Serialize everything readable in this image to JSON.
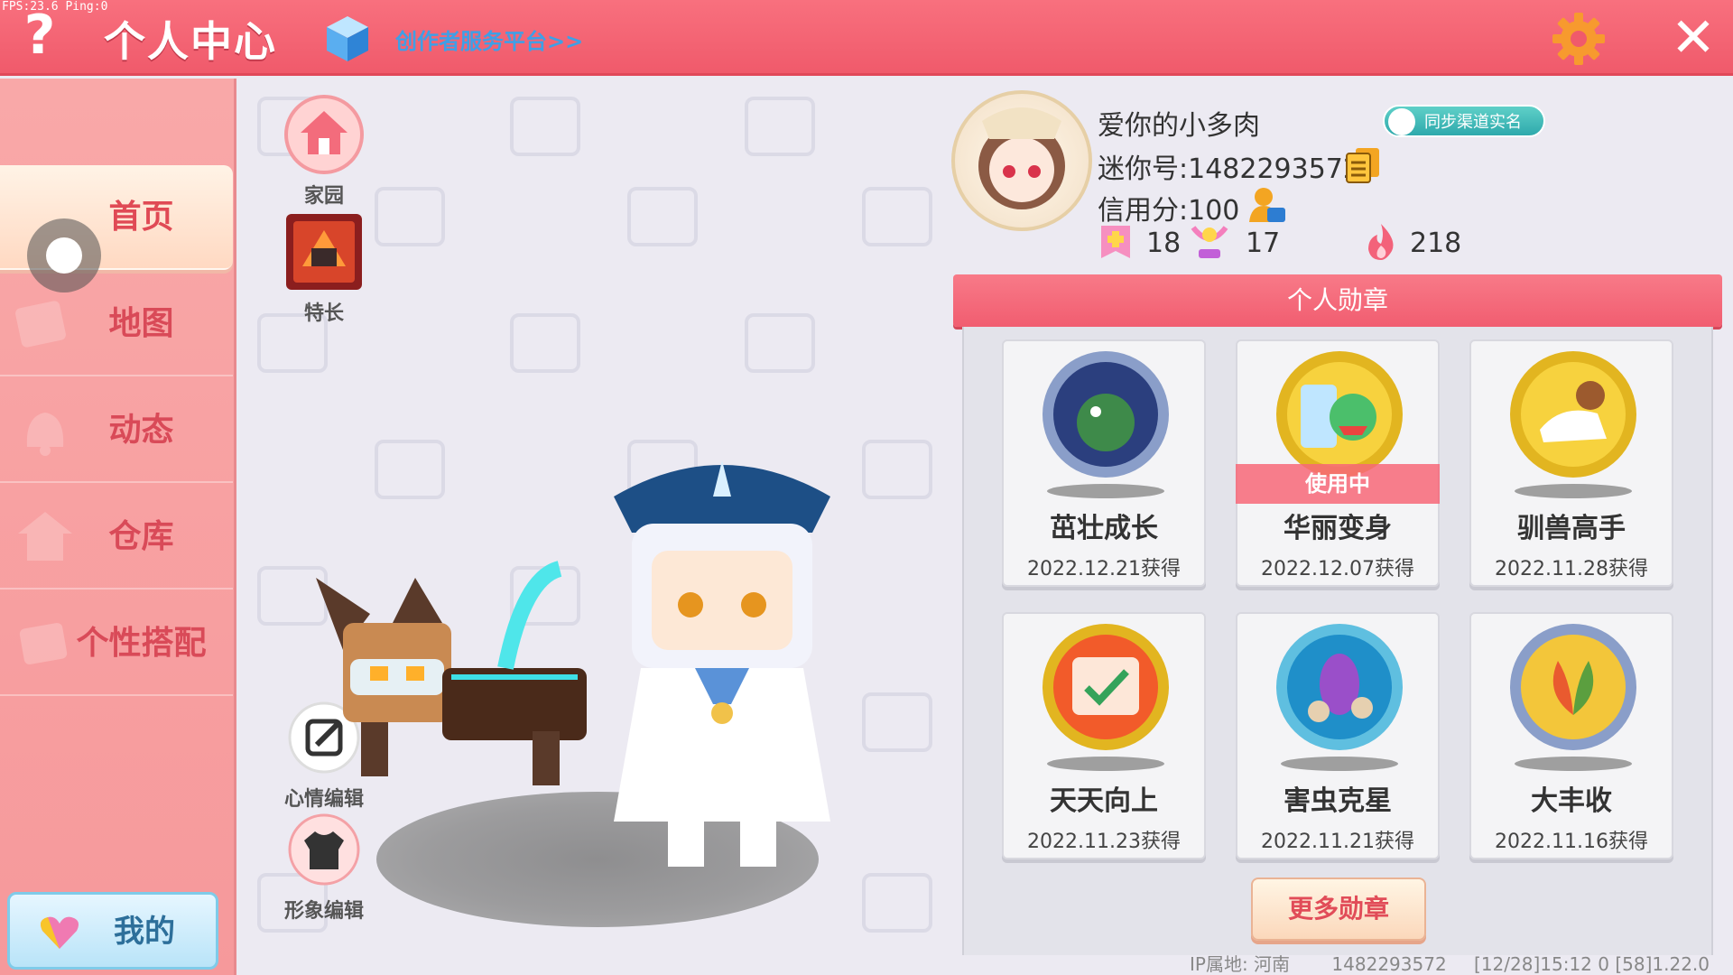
{
  "debug": {
    "fps_text": "FPS:23.6  Ping:0"
  },
  "topbar": {
    "help_glyph": "?",
    "title": "个人中心",
    "creator_link": "创作者服务平台>>",
    "close_glyph": "✕"
  },
  "sidebar": {
    "items": [
      {
        "label": "首页",
        "active": true
      },
      {
        "label": "地图",
        "active": false
      },
      {
        "label": "动态",
        "active": false
      },
      {
        "label": "仓库",
        "active": false
      },
      {
        "label": "个性搭配",
        "active": false
      }
    ],
    "mine_button": "我的"
  },
  "shortcuts": {
    "home": "家园",
    "talent": "特长",
    "mood_edit": "心情编辑",
    "image_edit": "形象编辑"
  },
  "profile": {
    "nickname": "爱你的小多肉",
    "realname_badge": "同步渠道实名",
    "mini_id": "迷你号:1482293572",
    "credit": "信用分:100",
    "stats": {
      "level": "18",
      "popularity": "17",
      "heat": "218"
    }
  },
  "badges": {
    "header": "个人勋章",
    "in_use_label": "使用中",
    "items": [
      {
        "name": "茁壮成长",
        "date": "2022.12.21获得",
        "in_use": false,
        "ring": "#8a9ec9"
      },
      {
        "name": "华丽变身",
        "date": "2022.12.07获得",
        "in_use": true,
        "ring": "#e2b520"
      },
      {
        "name": "驯兽高手",
        "date": "2022.11.28获得",
        "in_use": false,
        "ring": "#e2b520"
      },
      {
        "name": "天天向上",
        "date": "2022.11.23获得",
        "in_use": false,
        "ring": "#e2b520"
      },
      {
        "name": "害虫克星",
        "date": "2022.11.21获得",
        "in_use": false,
        "ring": "#5fbfe0"
      },
      {
        "name": "大丰收",
        "date": "2022.11.16获得",
        "in_use": false,
        "ring": "#8a9ec9"
      }
    ],
    "more_button": "更多勋章"
  },
  "footer": {
    "ip_location": "IP属地: 河南",
    "uid": "1482293572",
    "build": "[12/28]15:12 0  [58]1.22.0"
  },
  "icons": {
    "help": "question-icon",
    "cube": "cube-icon",
    "gear": "gear-icon",
    "close": "close-icon",
    "copy": "copy-icon",
    "credit": "credit-person-icon",
    "level": "level-flag-icon",
    "popularity": "trophy-icon",
    "heat": "flame-icon",
    "heart": "heart-icon"
  },
  "colors": {
    "topbar": "#f05a6b",
    "sidebar": "#f8a3a4",
    "accent_red": "#e04a55",
    "link_blue": "#3f9fe6"
  }
}
